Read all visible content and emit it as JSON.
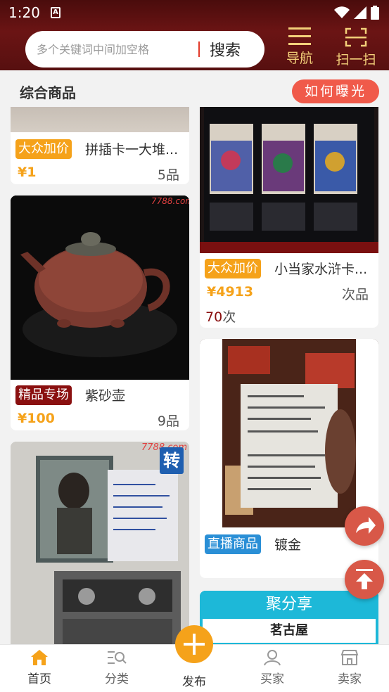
{
  "status": {
    "time": "1:20",
    "a_icon": "A"
  },
  "header": {
    "search_placeholder": "多个关键词中间加空格",
    "search_button": "搜索",
    "nav_label": "导航",
    "scan_label": "扫一扫"
  },
  "section": {
    "title": "综合商品",
    "expose_button": "如何曝光"
  },
  "cards": {
    "c1": {
      "tag": "大众加价",
      "title": "拼插卡一大堆...",
      "price": "¥1",
      "count": "5品"
    },
    "c2": {
      "tag": "大众加价",
      "title": "小当家水浒卡...",
      "price": "¥4913",
      "count": "次品",
      "bids": "70",
      "bids_unit": "次"
    },
    "c3": {
      "tag": "精品专场",
      "title": "紫砂壶",
      "price": "¥100",
      "count": "9品",
      "watermark": "7788.com"
    },
    "c4": {
      "tag": "直播商品",
      "title": "镀金"
    },
    "c5": {
      "watermark": "7788.com",
      "badge": "转"
    },
    "c6": {
      "header": "聚分享",
      "sub": "茗古屋"
    }
  },
  "bottom_nav": {
    "home": "首页",
    "category": "分类",
    "publish": "发布",
    "buyer": "买家",
    "seller": "卖家"
  },
  "colors": {
    "header": "#5a1010",
    "accent": "#f5a21a",
    "expose": "#f05a4a",
    "premium_tag": "#8a1010",
    "live_tag": "#2a8fd6"
  }
}
